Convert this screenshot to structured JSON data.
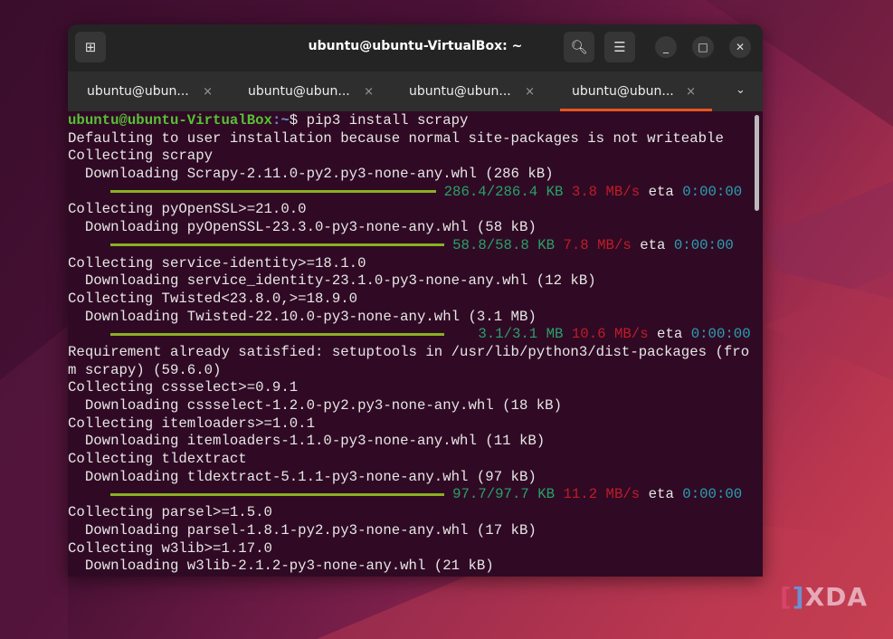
{
  "window": {
    "title": "ubuntu@ubuntu-VirtualBox: ~"
  },
  "icons": {
    "new_tab": "new-tab-icon",
    "search": "search-icon",
    "menu": "hamburger-icon",
    "minimize": "minimize-icon",
    "maximize": "maximize-icon",
    "close": "close-icon"
  },
  "tabs": [
    {
      "label": "ubuntu@ubun..."
    },
    {
      "label": "ubuntu@ubun..."
    },
    {
      "label": "ubuntu@ubun..."
    },
    {
      "label": "ubuntu@ubun...",
      "active": true
    }
  ],
  "tab_close": "×",
  "terminal": {
    "prompt_user": "ubuntu@ubuntu-VirtualBox",
    "prompt_path": ":~",
    "command": "$ pip3 install scrapy",
    "lines": [
      "Defaulting to user installation because normal site-packages is not writeable",
      "Collecting scrapy",
      "  Downloading Scrapy-2.11.0-py2.py3-none-any.whl (286 kB)",
      "Collecting pyOpenSSL>=21.0.0",
      "  Downloading pyOpenSSL-23.3.0-py3-none-any.whl (58 kB)",
      "Collecting service-identity>=18.1.0",
      "  Downloading service_identity-23.1.0-py3-none-any.whl (12 kB)",
      "Collecting Twisted<23.8.0,>=18.9.0",
      "  Downloading Twisted-22.10.0-py3-none-any.whl (3.1 MB)",
      "Requirement already satisfied: setuptools in /usr/lib/python3/dist-packages (fro",
      "m scrapy) (59.6.0)",
      "Collecting cssselect>=0.9.1",
      "  Downloading cssselect-1.2.0-py2.py3-none-any.whl (18 kB)",
      "Collecting itemloaders>=1.0.1",
      "  Downloading itemloaders-1.1.0-py3-none-any.whl (11 kB)",
      "Collecting tldextract",
      "  Downloading tldextract-5.1.1-py3-none-any.whl (97 kB)",
      "Collecting parsel>=1.5.0",
      "  Downloading parsel-1.8.1-py2.py3-none-any.whl (17 kB)",
      "Collecting w3lib>=1.17.0",
      "  Downloading w3lib-2.1.2-py3-none-any.whl (21 kB)"
    ],
    "progress": [
      {
        "size": "286.4/286.4 KB",
        "speed": "3.8 MB/s",
        "eta_label": "eta",
        "eta": "0:00:00",
        "fraction": 1.0
      },
      {
        "size": "58.8/58.8 KB",
        "speed": "7.8 MB/s",
        "eta_label": "eta",
        "eta": "0:00:00",
        "fraction": 1.0
      },
      {
        "size": "3.1/3.1 MB",
        "speed": "10.6 MB/s",
        "eta_label": "eta",
        "eta": "0:00:00",
        "fraction": 1.0
      },
      {
        "size": "97.7/97.7 KB",
        "speed": "11.2 MB/s",
        "eta_label": "eta",
        "eta": "0:00:00",
        "fraction": 1.0
      }
    ]
  },
  "watermark": "XDA"
}
